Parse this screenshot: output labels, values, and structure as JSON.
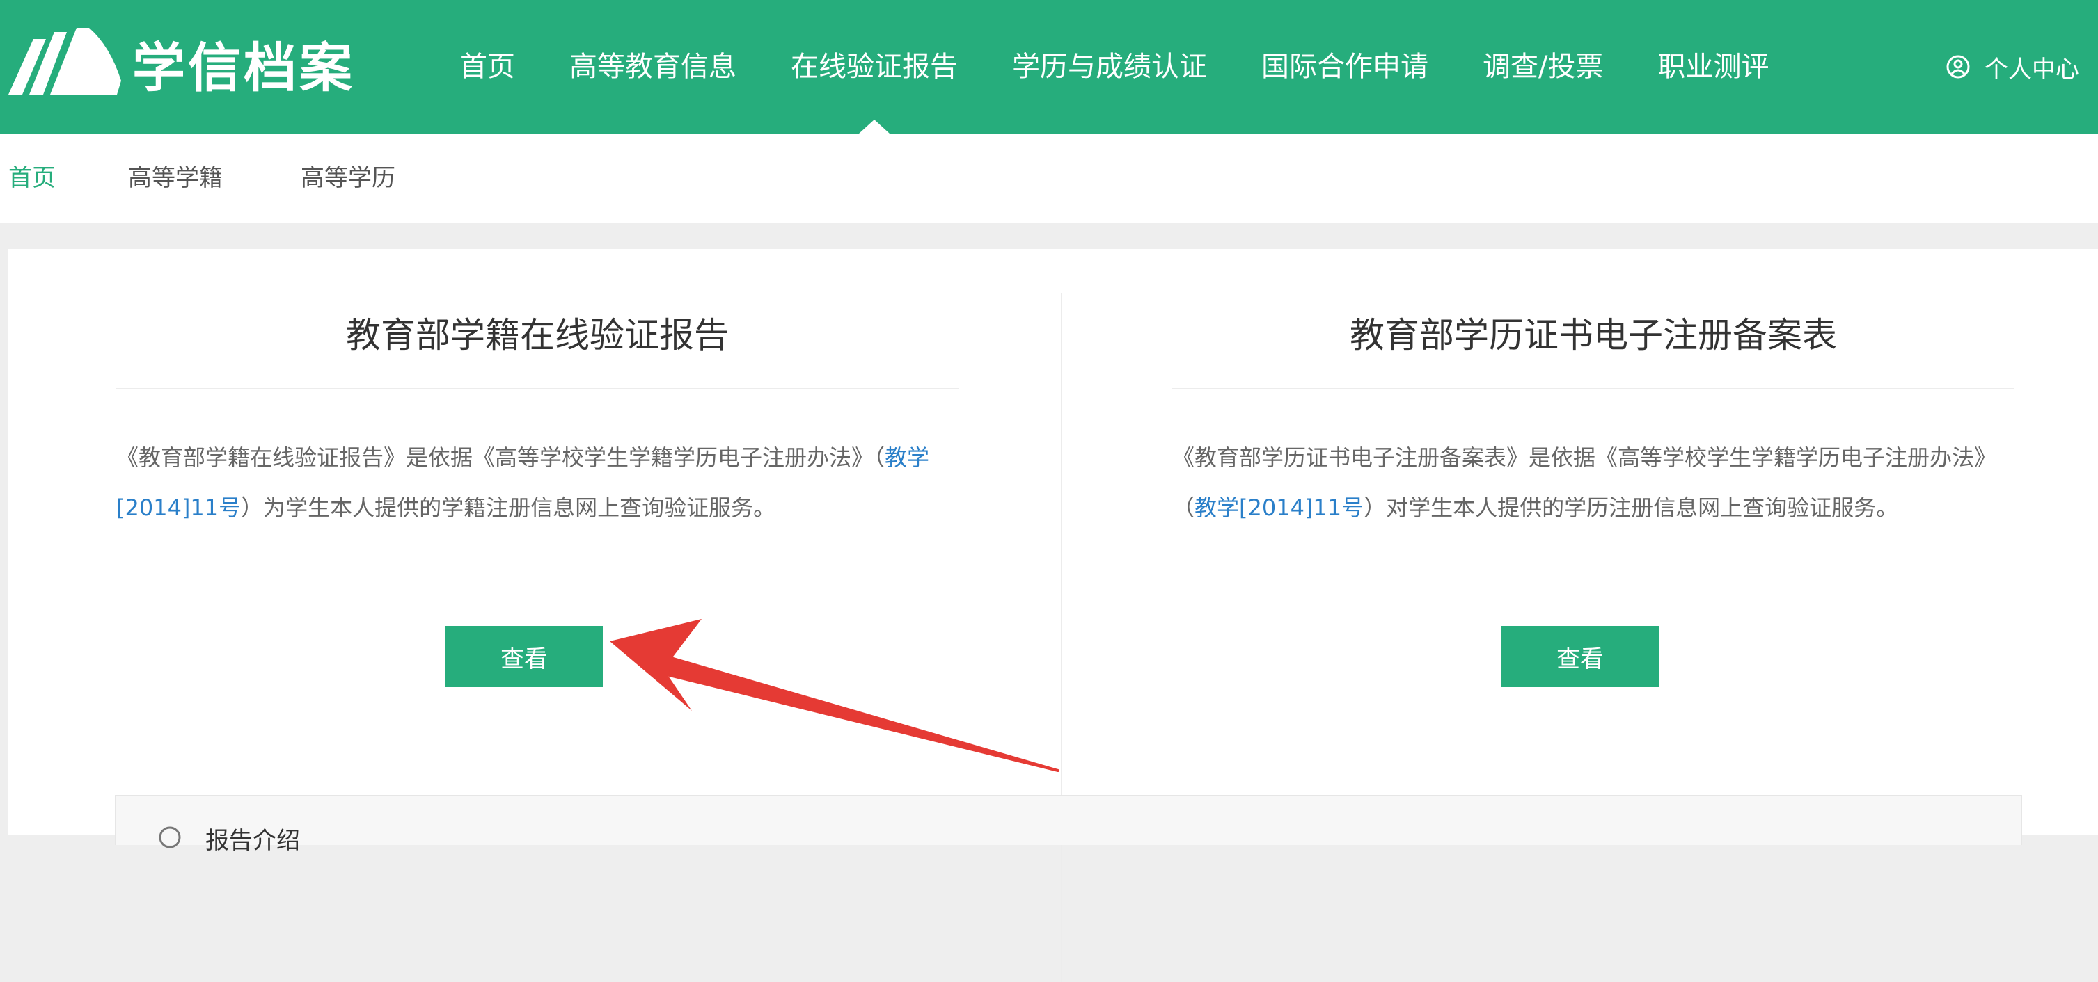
{
  "header": {
    "brand": "学信档案",
    "nav": [
      {
        "label": "首页"
      },
      {
        "label": "高等教育信息"
      },
      {
        "label": "在线验证报告",
        "active": true
      },
      {
        "label": "学历与成绩认证"
      },
      {
        "label": "国际合作申请"
      },
      {
        "label": "调查/投票"
      },
      {
        "label": "职业测评"
      }
    ],
    "user_label": "个人中心"
  },
  "subnav": {
    "items": [
      "首页",
      "高等学籍",
      "高等学历"
    ]
  },
  "cards": [
    {
      "title": "教育部学籍在线验证报告",
      "desc_before": "《教育部学籍在线验证报告》是依据《高等学校学生学籍学历电子注册办法》（",
      "desc_link": "教学[2014]11号",
      "desc_after": "）为学生本人提供的学籍注册信息网上查询验证服务。",
      "button": "查看"
    },
    {
      "title": "教育部学历证书电子注册备案表",
      "desc_before": "《教育部学历证书电子注册备案表》是依据《高等学校学生学籍学历电子注册办法》（",
      "desc_link": "教学[2014]11号",
      "desc_after": "）对学生本人提供的学历注册信息网上查询验证服务。",
      "button": "查看"
    }
  ],
  "bottom": {
    "label": "报告介绍"
  },
  "colors": {
    "brand_green": "#26ad7c",
    "link_blue": "#2a7fc9",
    "arrow_red": "#e53a34"
  }
}
